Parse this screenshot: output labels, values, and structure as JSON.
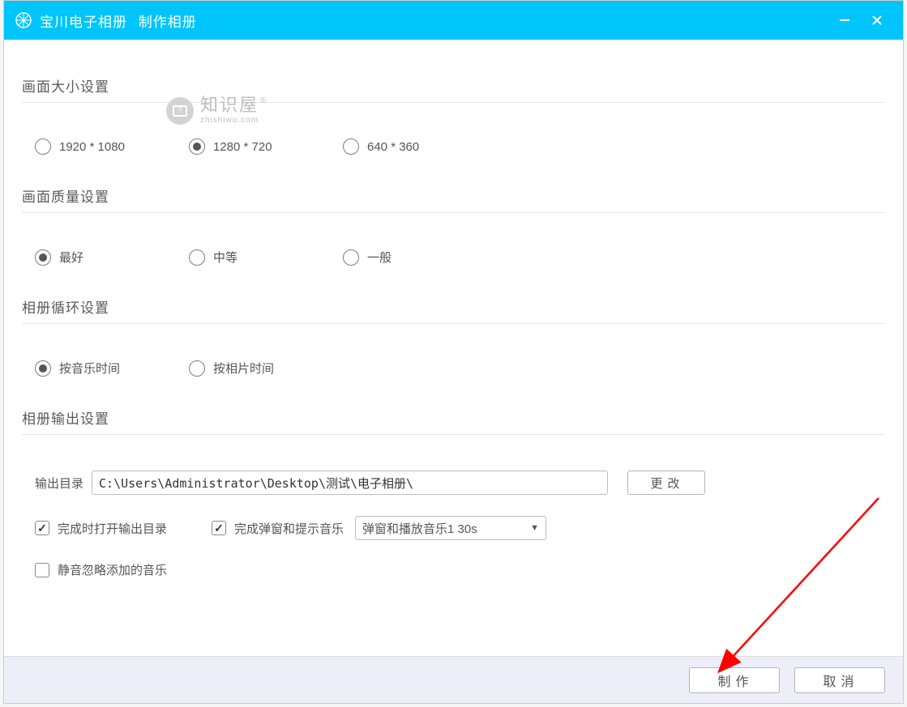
{
  "titlebar": {
    "app_name": "宝川电子相册",
    "subtitle": "制作相册"
  },
  "watermark": {
    "main": "知识屋",
    "sub": "zhishiwu.com"
  },
  "sections": {
    "size": {
      "title": "画面大小设置",
      "opts": [
        "1920 * 1080",
        "1280 * 720",
        "640 * 360"
      ],
      "selected": 1
    },
    "quality": {
      "title": "画面质量设置",
      "opts": [
        "最好",
        "中等",
        "一般"
      ],
      "selected": 0
    },
    "loop": {
      "title": "相册循环设置",
      "opts": [
        "按音乐时间",
        "按相片时间"
      ],
      "selected": 0
    },
    "output": {
      "title": "相册输出设置",
      "dir_label": "输出目录",
      "dir_value": "C:\\Users\\Administrator\\Desktop\\测试\\电子相册\\",
      "change_btn": "更改",
      "chk_open": "完成时打开输出目录",
      "chk_popup": "完成弹窗和提示音乐",
      "dropdown": "弹窗和播放音乐1  30s",
      "chk_mute": "静音忽略添加的音乐"
    }
  },
  "footer": {
    "make": "制作",
    "cancel": "取消"
  }
}
